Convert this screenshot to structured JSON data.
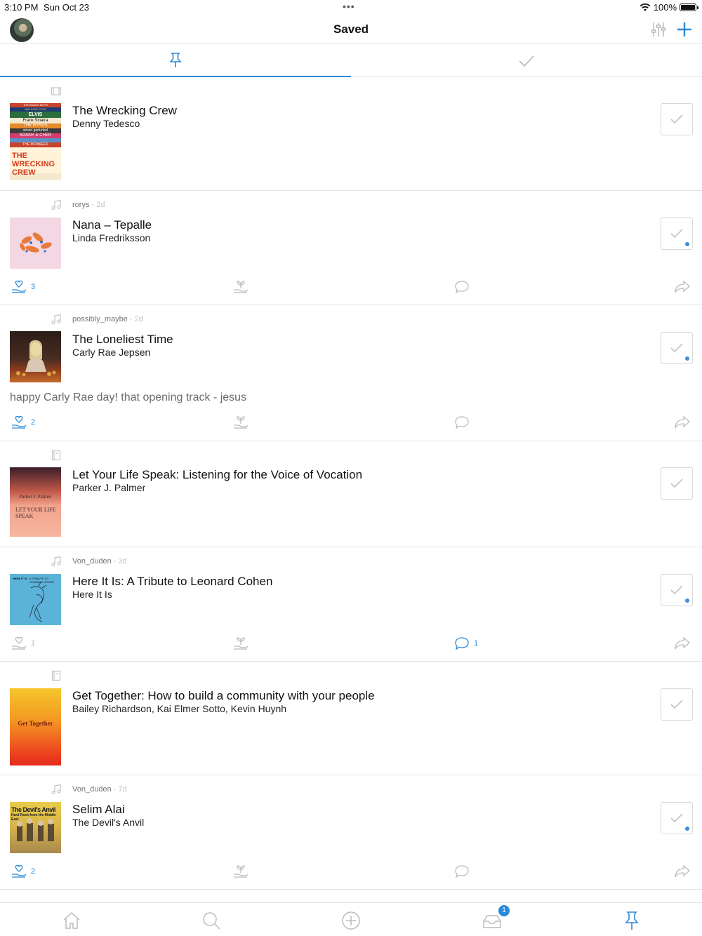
{
  "status": {
    "time": "3:10 PM",
    "date": "Sun Oct 23",
    "battery": "100%"
  },
  "header": {
    "title": "Saved"
  },
  "colors": {
    "accent": "#2a89d8",
    "divider": "#e2e2e2",
    "muted": "#bbbbbb"
  },
  "tabs": [
    {
      "name": "pinned",
      "icon": "pin-icon",
      "active": true
    },
    {
      "name": "done",
      "icon": "check-icon",
      "active": false
    }
  ],
  "cards": [
    {
      "type_icon": "film-icon",
      "user": "",
      "ago": "",
      "title": "The Wrecking Crew",
      "subtitle": "Denny Tedesco",
      "comment": "",
      "likes": "",
      "replies": ""
    },
    {
      "type_icon": "music-icon",
      "user": "rorys",
      "ago": "2d",
      "title": "Nana – Tepalle",
      "subtitle": "Linda Fredriksson",
      "comment": "",
      "likes": "3",
      "replies": ""
    },
    {
      "type_icon": "music-icon",
      "user": "possibly_maybe",
      "ago": "2d",
      "title": "The Loneliest Time",
      "subtitle": "Carly Rae Jepsen",
      "comment": "happy Carly Rae day! that opening track - jesus",
      "likes": "2",
      "replies": ""
    },
    {
      "type_icon": "book-icon",
      "user": "",
      "ago": "",
      "title": "Let Your Life Speak: Listening for the Voice of Vocation",
      "subtitle": "Parker J. Palmer",
      "comment": "",
      "likes": "",
      "replies": ""
    },
    {
      "type_icon": "music-icon",
      "user": "Von_duden",
      "ago": "3d",
      "title": "Here It Is: A Tribute to Leonard Cohen",
      "subtitle": "Here It Is",
      "comment": "",
      "likes": "1",
      "replies": "1"
    },
    {
      "type_icon": "book-icon",
      "user": "",
      "ago": "",
      "title": "Get Together: How to build a community with your people",
      "subtitle": "Bailey  Richardson, Kai Elmer Sotto, Kevin  Huynh",
      "comment": "",
      "likes": "",
      "replies": ""
    },
    {
      "type_icon": "music-icon",
      "user": "Von_duden",
      "ago": "7d",
      "title": "Selim Alai",
      "subtitle": "The Devil's Anvil",
      "comment": "",
      "likes": "2",
      "replies": ""
    }
  ],
  "covers": {
    "wrecking": [
      "THE BEACH BOYS",
      "NAT KING COLE",
      "ELVIS",
      "Frank Sinatra",
      "THE BYRDS",
      "simon garfunkel",
      "SONNY & CHER",
      "THE MONKEES",
      "THE WRECKING CREW"
    ],
    "palmer": [
      "Parker J. Palmer",
      "LET YOUR LIFE SPEAK"
    ],
    "cohen": [
      "HERE IT IS",
      "A TRIBUTE TO LEONARD COHEN"
    ],
    "together": [
      "Get Together"
    ],
    "devils": [
      "The Devil's Anvil",
      "Hard Rock from the Middle East"
    ]
  },
  "tabbar": {
    "inbox_badge": "1"
  }
}
